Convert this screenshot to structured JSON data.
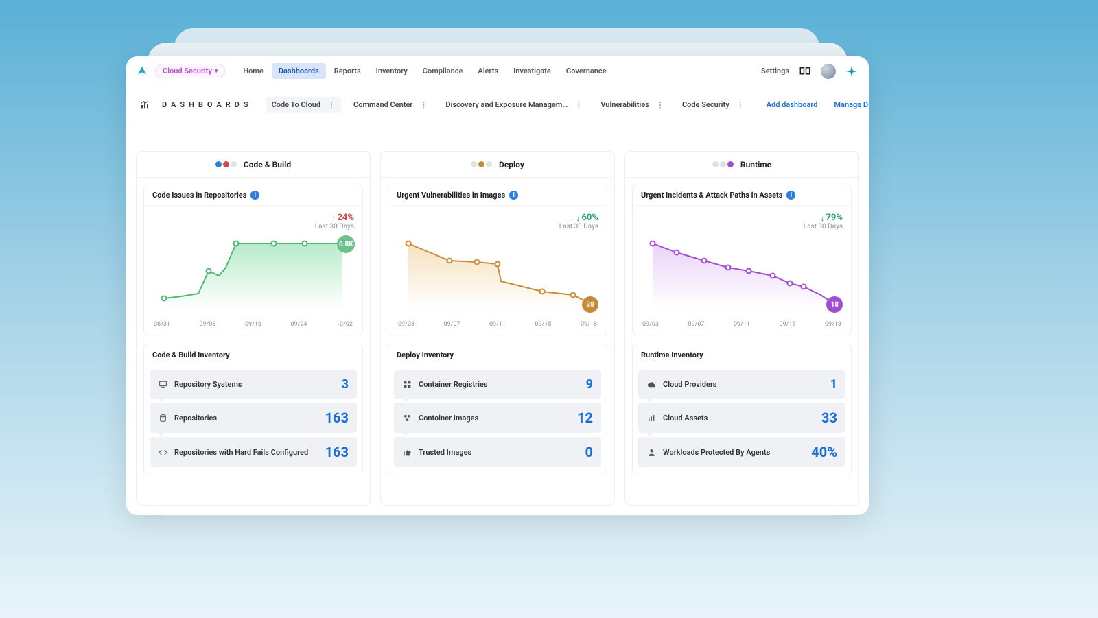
{
  "tenant": {
    "label": "Cloud Security"
  },
  "nav": {
    "items": [
      {
        "label": "Home"
      },
      {
        "label": "Dashboards",
        "active": true
      },
      {
        "label": "Reports"
      },
      {
        "label": "Inventory"
      },
      {
        "label": "Compliance"
      },
      {
        "label": "Alerts"
      },
      {
        "label": "Investigate"
      },
      {
        "label": "Governance"
      }
    ],
    "settings": "Settings"
  },
  "subheader": {
    "title": "DASHBOARDS",
    "tabs": [
      {
        "label": "Code To Cloud",
        "active": true
      },
      {
        "label": "Command Center"
      },
      {
        "label": "Discovery and Exposure Managem…"
      },
      {
        "label": "Vulnerabilities"
      },
      {
        "label": "Code Security"
      }
    ],
    "add": "Add dashboard",
    "manage": "Manage Dashboards"
  },
  "columns": {
    "code": {
      "title": "Code & Build",
      "chart_title": "Code Issues in Repositories",
      "trend_value": "24%",
      "trend_dir": "up",
      "trend_period": "Last 30 Days",
      "endpoint": "6.8K",
      "xaxis": [
        "08/31",
        "09/08",
        "09/16",
        "09/24",
        "10/02"
      ],
      "inv_title": "Code & Build Inventory",
      "inv": [
        {
          "label": "Repository Systems",
          "value": "3"
        },
        {
          "label": "Repositories",
          "value": "163"
        },
        {
          "label": "Repositories with Hard Fails Configured",
          "value": "163"
        }
      ]
    },
    "deploy": {
      "title": "Deploy",
      "chart_title": "Urgent Vulnerabilities in Images",
      "trend_value": "60%",
      "trend_dir": "down",
      "trend_period": "Last 30 Days",
      "endpoint": "38",
      "xaxis": [
        "09/03",
        "09/07",
        "09/11",
        "09/15",
        "09/18"
      ],
      "inv_title": "Deploy Inventory",
      "inv": [
        {
          "label": "Container Registries",
          "value": "9"
        },
        {
          "label": "Container Images",
          "value": "12"
        },
        {
          "label": "Trusted Images",
          "value": "0"
        }
      ]
    },
    "runtime": {
      "title": "Runtime",
      "chart_title": "Urgent Incidents & Attack Paths in Assets",
      "trend_value": "79%",
      "trend_dir": "down",
      "trend_period": "Last 30 Days",
      "endpoint": "18",
      "xaxis": [
        "09/03",
        "09/07",
        "09/11",
        "09/15",
        "09/18"
      ],
      "inv_title": "Runtime Inventory",
      "inv": [
        {
          "label": "Cloud Providers",
          "value": "1"
        },
        {
          "label": "Cloud Assets",
          "value": "33"
        },
        {
          "label": "Workloads Protected By Agents",
          "value": "40%"
        }
      ]
    }
  },
  "chart_data": [
    {
      "type": "area",
      "title": "Code Issues in Repositories",
      "series_name": "Code Issues",
      "x": [
        "08/31",
        "09/04",
        "09/08",
        "09/10",
        "09/12",
        "09/16",
        "09/24",
        "10/02"
      ],
      "y": [
        1600,
        1700,
        3100,
        3400,
        6800,
        6800,
        6800,
        6800
      ],
      "ylim": [
        0,
        7200
      ],
      "color": "#6cc28b",
      "endpoint_label": "6.8K",
      "trend_pct": 24,
      "trend_direction": "up",
      "period": "Last 30 Days"
    },
    {
      "type": "area",
      "title": "Urgent Vulnerabilities in Images",
      "series_name": "Urgent Vulnerabilities",
      "x": [
        "09/03",
        "09/07",
        "09/09",
        "09/11",
        "09/13",
        "09/15",
        "09/18"
      ],
      "y": [
        95,
        78,
        73,
        70,
        52,
        48,
        38
      ],
      "ylim": [
        0,
        100
      ],
      "color": "#c88a35",
      "endpoint_label": "38",
      "trend_pct": 60,
      "trend_direction": "down",
      "period": "Last 30 Days"
    },
    {
      "type": "area",
      "title": "Urgent Incidents & Attack Paths in Assets",
      "series_name": "Urgent Incidents & Attack Paths",
      "x": [
        "09/03",
        "09/05",
        "09/07",
        "09/09",
        "09/11",
        "09/13",
        "09/15",
        "09/17",
        "09/18"
      ],
      "y": [
        85,
        74,
        66,
        58,
        54,
        49,
        40,
        35,
        18
      ],
      "ylim": [
        0,
        90
      ],
      "color": "#a14fd1",
      "endpoint_label": "18",
      "trend_pct": 79,
      "trend_direction": "down",
      "period": "Last 30 Days"
    }
  ]
}
